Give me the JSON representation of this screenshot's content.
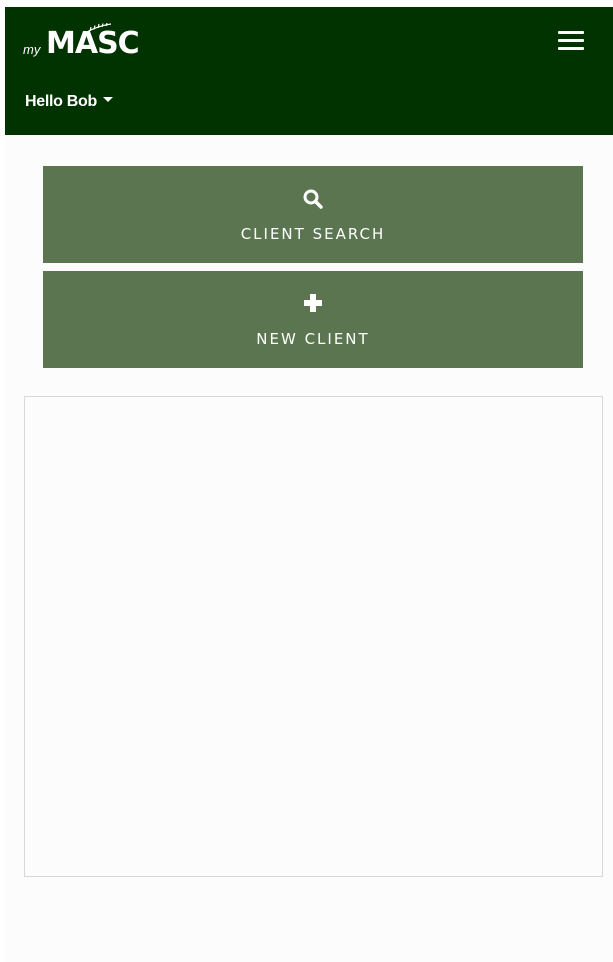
{
  "header": {
    "logo_prefix": "my",
    "logo_brand": "MASC",
    "user_greeting": "Hello Bob",
    "menu_icon": "hamburger-menu-icon"
  },
  "actions": [
    {
      "label": "CLIENT SEARCH",
      "icon": "search-icon"
    },
    {
      "label": "NEW CLIENT",
      "icon": "plus-icon"
    }
  ],
  "colors": {
    "header_bg": "#003300",
    "button_bg": "#5a7550",
    "page_bg": "#fcfcfc",
    "text_light": "#ffffff"
  }
}
